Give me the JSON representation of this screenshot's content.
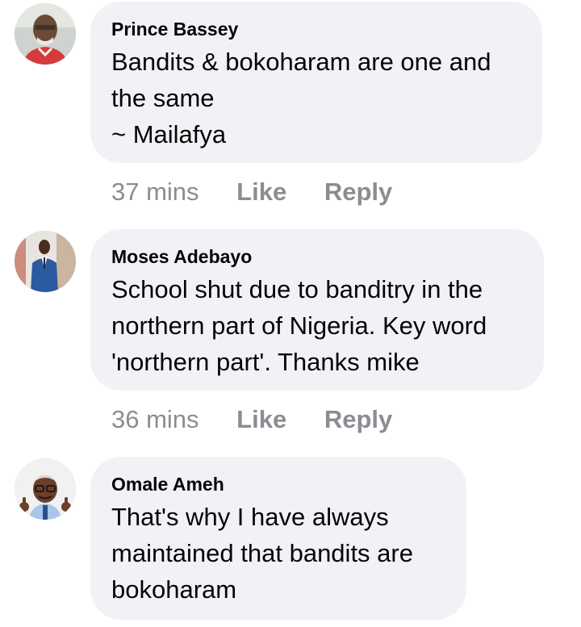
{
  "comments": [
    {
      "author": "Prince Bassey",
      "text": "Bandits & bokoharam are one and\nthe same\n~ Mailafya",
      "time": "37 mins",
      "like_label": "Like",
      "reply_label": "Reply",
      "avatar_icon": "profile-photo-man-red-shirt"
    },
    {
      "author": "Moses Adebayo",
      "text": "School shut due to banditry in the\nnorthern part of Nigeria. Key word\n'northern part'. Thanks mike",
      "time": "36 mins",
      "like_label": "Like",
      "reply_label": "Reply",
      "avatar_icon": "profile-photo-man-blue-suit"
    },
    {
      "author": "Omale Ameh",
      "text": "That's why I have always\nmaintained that bandits are\nbokoharam",
      "avatar_icon": "cartoon-avatar-thumbs-up"
    }
  ],
  "colors": {
    "bubble": "#f0f2f5",
    "text": "#050505",
    "meta": "#8a8d91"
  }
}
